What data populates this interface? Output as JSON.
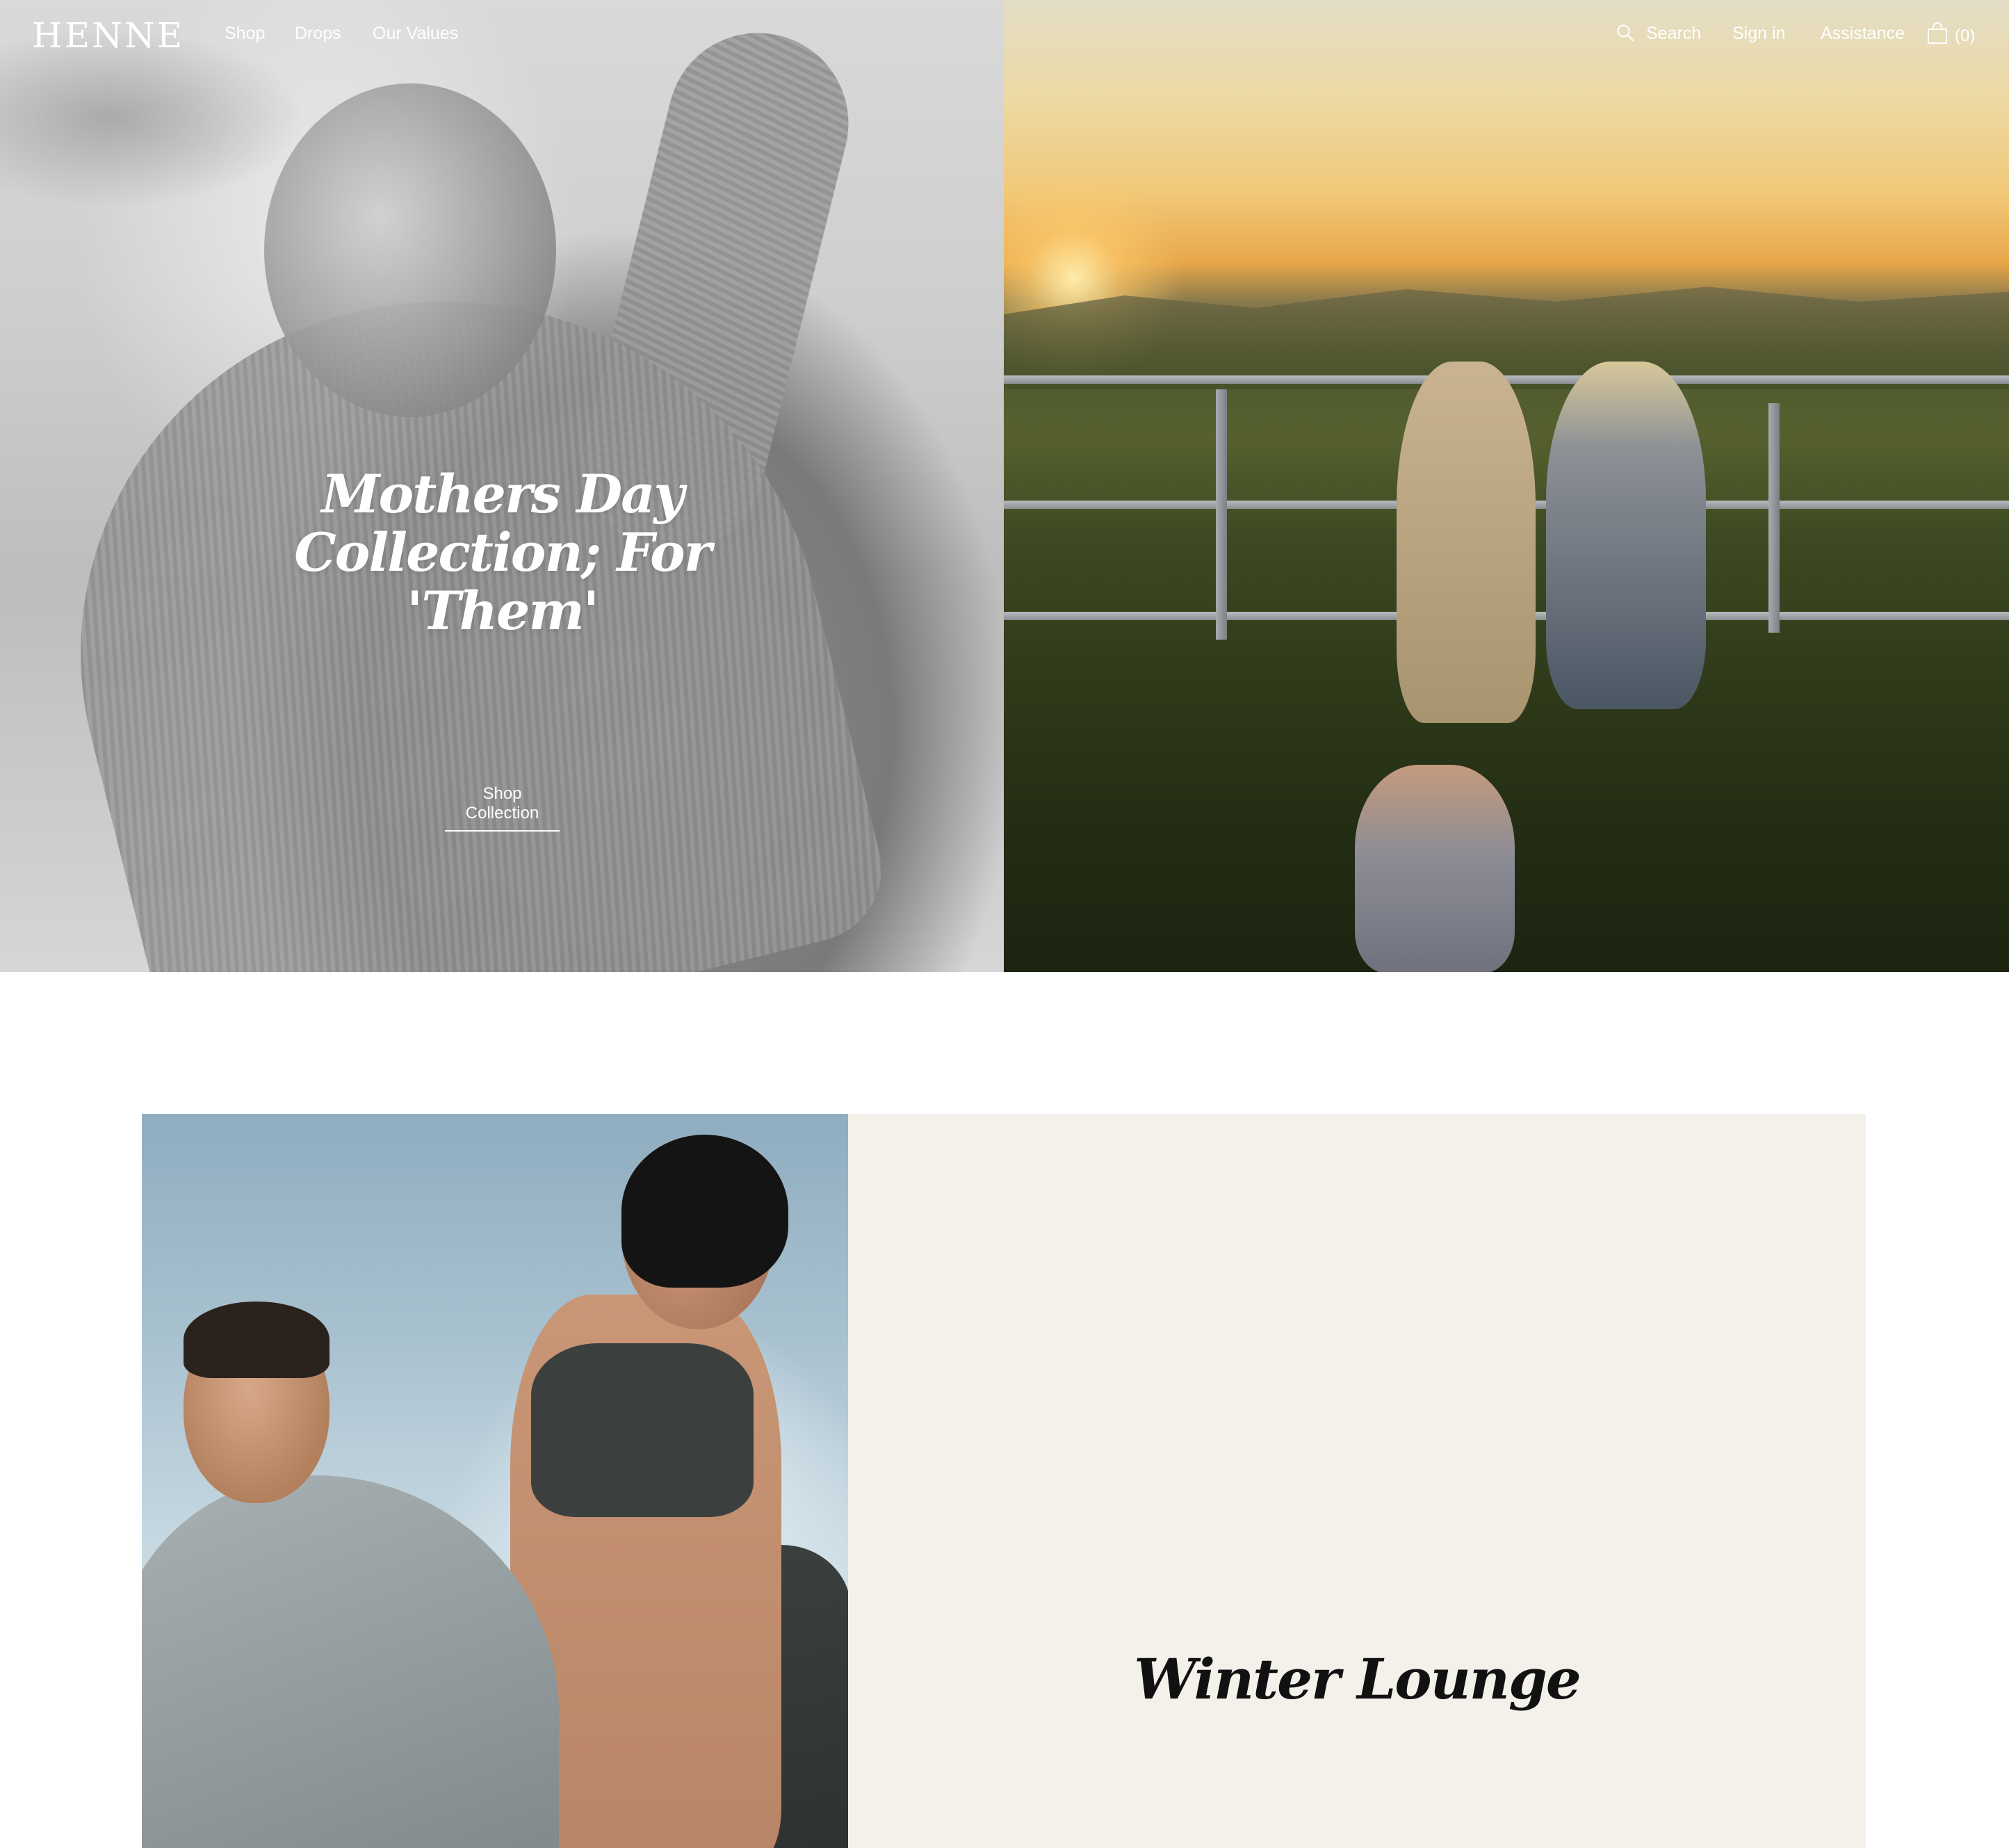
{
  "header": {
    "logo": "HENNE",
    "nav": {
      "shop": "Shop",
      "drops": "Drops",
      "our_values": "Our Values"
    },
    "utility": {
      "search": "Search",
      "sign_in": "Sign in",
      "assistance": "Assistance",
      "cart_count": "(0)"
    },
    "icons": {
      "search": "search-icon",
      "cart": "shopping-bag-icon"
    }
  },
  "hero": {
    "title": "Mothers Day Collection; For 'Them'",
    "cta": "Shop Collection"
  },
  "feature": {
    "title": "Winter Lounge"
  },
  "colors": {
    "text_on_image": "#ffffff",
    "feature_panel_bg": "#f4f1ea",
    "feature_title": "#111111"
  }
}
